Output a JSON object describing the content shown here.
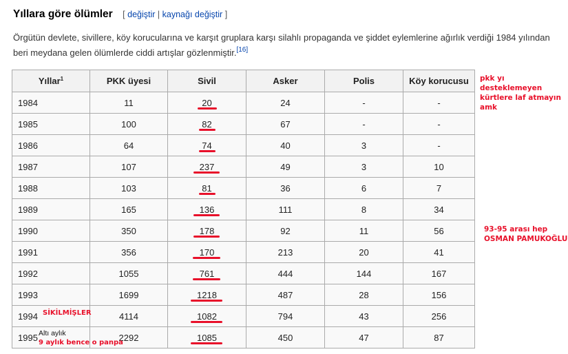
{
  "section": {
    "title": "Yıllara göre ölümler",
    "edit_bracket_open": "[",
    "edit_link": "değiştir",
    "separator": "|",
    "edit_source_link": "kaynağı değiştir",
    "edit_bracket_close": "]"
  },
  "paragraph": {
    "text": "Örgütün devlete, sivillere, köy korucularına ve karşıt gruplara karşı silahlı propaganda ve şiddet eylemlerine ağırlık verdiği 1984 yılından beri meydana gelen ölümlerde ciddi artışlar gözlenmiştir.",
    "citation": "[16]"
  },
  "table": {
    "headers": [
      "Yıllar",
      "PKK üyesi",
      "Sivil",
      "Asker",
      "Polis",
      "Köy korucusu"
    ],
    "header_footnote": "1",
    "rows": [
      {
        "year": "1984",
        "pkk": "11",
        "civil": "20",
        "soldier": "24",
        "police": "-",
        "guard": "-"
      },
      {
        "year": "1985",
        "pkk": "100",
        "civil": "82",
        "soldier": "67",
        "police": "-",
        "guard": "-"
      },
      {
        "year": "1986",
        "pkk": "64",
        "civil": "74",
        "soldier": "40",
        "police": "3",
        "guard": "-"
      },
      {
        "year": "1987",
        "pkk": "107",
        "civil": "237",
        "soldier": "49",
        "police": "3",
        "guard": "10"
      },
      {
        "year": "1988",
        "pkk": "103",
        "civil": "81",
        "soldier": "36",
        "police": "6",
        "guard": "7"
      },
      {
        "year": "1989",
        "pkk": "165",
        "civil": "136",
        "soldier": "111",
        "police": "8",
        "guard": "34"
      },
      {
        "year": "1990",
        "pkk": "350",
        "civil": "178",
        "soldier": "92",
        "police": "11",
        "guard": "56"
      },
      {
        "year": "1991",
        "pkk": "356",
        "civil": "170",
        "soldier": "213",
        "police": "20",
        "guard": "41"
      },
      {
        "year": "1992",
        "pkk": "1055",
        "civil": "761",
        "soldier": "444",
        "police": "144",
        "guard": "167"
      },
      {
        "year": "1993",
        "pkk": "1699",
        "civil": "1218",
        "soldier": "487",
        "police": "28",
        "guard": "156"
      },
      {
        "year": "1994",
        "pkk": "4114",
        "civil": "1082",
        "soldier": "794",
        "police": "43",
        "guard": "256"
      },
      {
        "year": "1995",
        "pkk": "2292",
        "civil": "1085",
        "soldier": "450",
        "police": "47",
        "guard": "87"
      }
    ],
    "row_1995_note": "Altı aylık"
  },
  "annotations": {
    "top_right": "pkk yı desteklemeyen kürtlere laf atmayın amk",
    "middle_right_line1": "93-95 arası hep",
    "middle_right_line2": "OSMAN PAMUKOĞLU",
    "row_1994": "SİKİLMİŞLER",
    "bottom_left": "9 aylık bence o panpa",
    "color": "#e8102a"
  }
}
